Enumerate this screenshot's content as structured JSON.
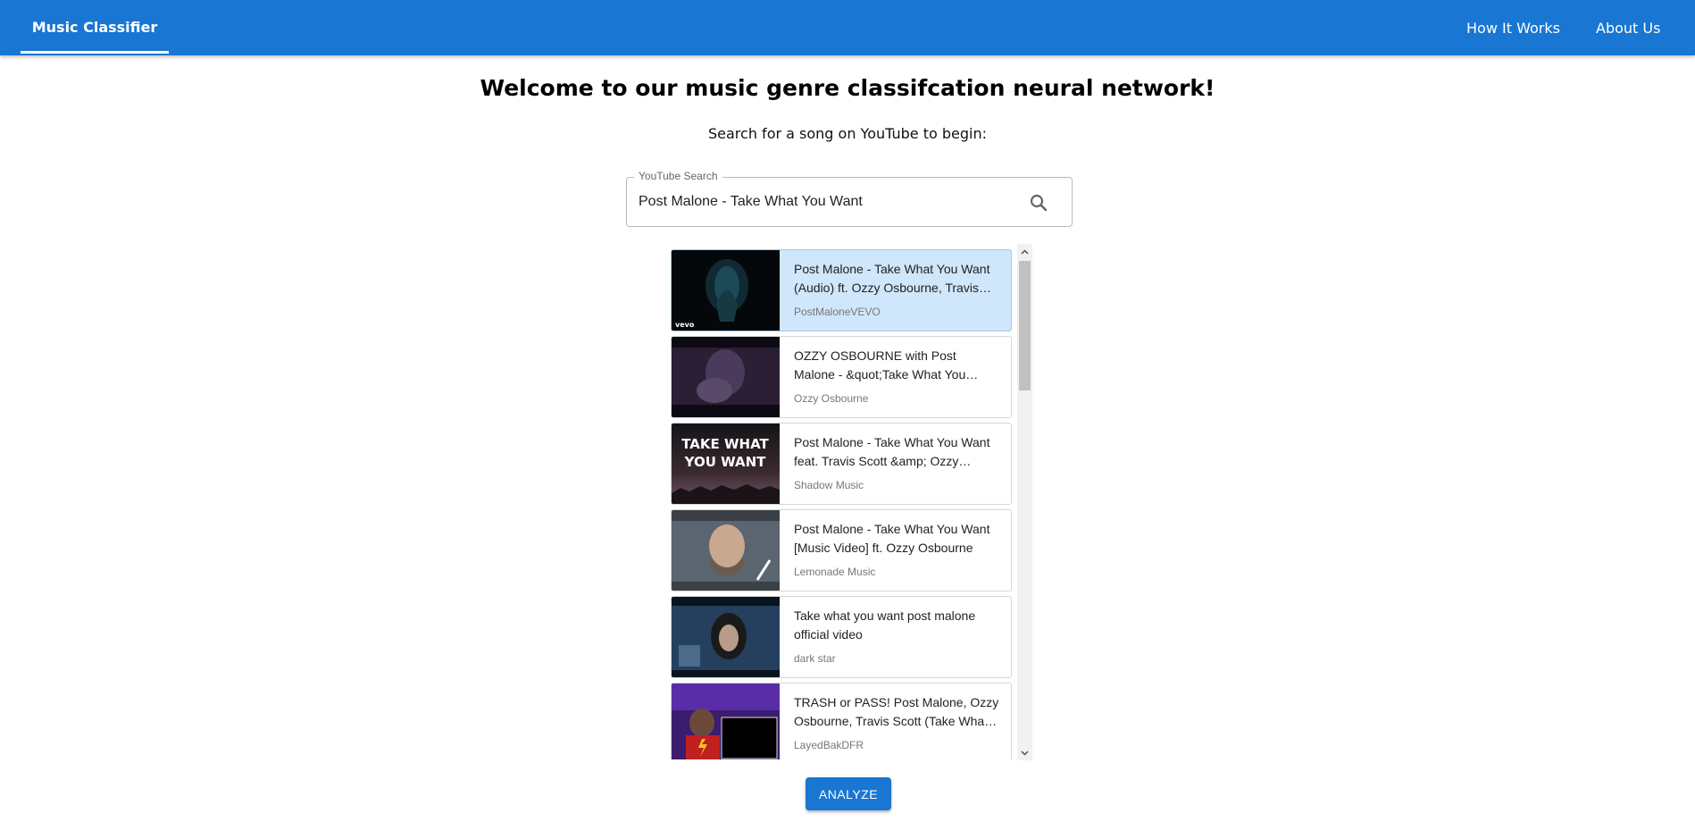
{
  "app": {
    "brand": "Music Classifier",
    "nav": {
      "how_it_works": "How It Works",
      "about_us": "About Us"
    }
  },
  "main": {
    "heading": "Welcome to our music genre classifcation neural network!",
    "subheading": "Search for a song on YouTube to begin:"
  },
  "search": {
    "label": "YouTube Search",
    "value": "Post Malone - Take What You Want",
    "icon": "search-icon"
  },
  "results": [
    {
      "title": "Post Malone - Take What You Want (Audio) ft. Ozzy Osbourne, Travis Scott",
      "channel": "PostMaloneVEVO",
      "selected": true
    },
    {
      "title": "OZZY OSBOURNE with Post Malone - &quot;Take What You Want&quot;",
      "channel": "Ozzy Osbourne",
      "selected": false
    },
    {
      "title": "Post Malone - Take What You Want feat. Travis Scott &amp; Ozzy Osbourne",
      "channel": "Shadow Music",
      "selected": false,
      "thumb_text": [
        "TAKE WHAT",
        "YOU WANT"
      ]
    },
    {
      "title": "Post Malone - Take What You Want [Music Video] ft. Ozzy Osbourne",
      "channel": "Lemonade Music",
      "selected": false
    },
    {
      "title": "Take what you want post malone official video",
      "channel": "dark star",
      "selected": false
    },
    {
      "title": "TRASH or PASS! Post Malone, Ozzy Osbourne, Travis Scott (Take What You Want)",
      "channel": "LayedBakDFR",
      "selected": false
    }
  ],
  "thumbnail_badge": "vevo",
  "actions": {
    "analyze": "ANALYZE"
  },
  "colors": {
    "primary": "#1976d2",
    "selected_bg": "#cfe6fb"
  }
}
